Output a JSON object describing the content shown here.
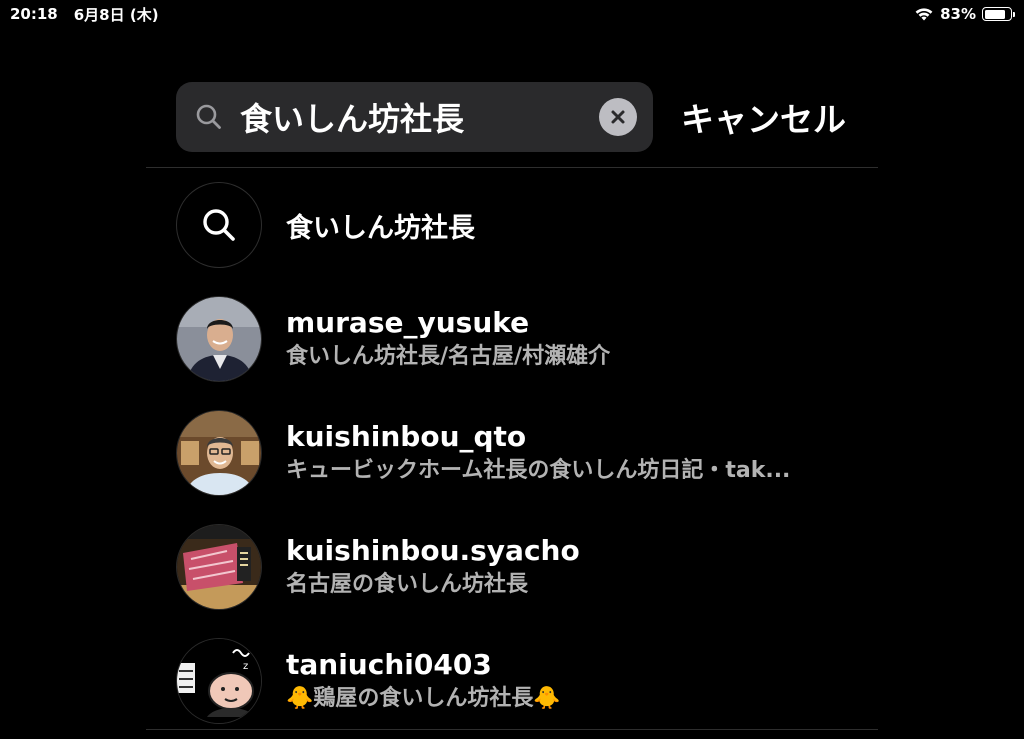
{
  "status_bar": {
    "time": "20:18",
    "date": "6月8日 (木)",
    "battery_percent": "83%",
    "battery_level": 0.83
  },
  "search": {
    "query": "食いしん坊社長",
    "cancel_label": "キャンセル"
  },
  "results": {
    "query_suggestion": "食いしん坊社長",
    "accounts": [
      {
        "username": "murase_yusuke",
        "subtitle": "食いしん坊社長/名古屋/村瀬雄介",
        "avatar_icon": "portrait-man-suit"
      },
      {
        "username": "kuishinbou_qto",
        "subtitle": "キュービックホーム社長の食いしん坊日記・tak...",
        "avatar_icon": "portrait-man-glasses"
      },
      {
        "username": "kuishinbou.syacho",
        "subtitle": "名古屋の食いしん坊社長",
        "avatar_icon": "wagyu-beef-photo"
      },
      {
        "username": "taniuchi0403",
        "subtitle_prefix_emoji": "🐥",
        "subtitle": "鶏屋の食いしん坊社長",
        "subtitle_suffix_emoji": "🐥",
        "avatar_icon": "cartoon-chef-illustration"
      }
    ]
  }
}
